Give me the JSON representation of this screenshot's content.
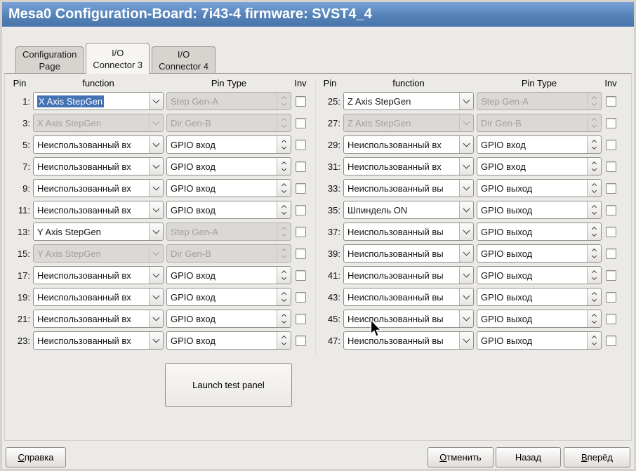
{
  "window": {
    "title": "Mesa0 Configuration-Board: 7i43-4 firmware: SVST4_4"
  },
  "colors": {
    "titlebar_blue": "#5582b8",
    "selection_blue": "#4272b4"
  },
  "tabs": [
    {
      "line1": "Configuration",
      "line2": "Page",
      "active": false
    },
    {
      "line1": "I/O",
      "line2": "Connector 3",
      "active": true
    },
    {
      "line1": "I/O",
      "line2": "Connector 4",
      "active": false
    }
  ],
  "columns": {
    "pin": "Pin",
    "function": "function",
    "pin_type": "Pin Type",
    "inv": "Inv"
  },
  "left_rows": [
    {
      "pin": "1:",
      "function": "X Axis StepGen",
      "function_disabled": false,
      "function_selected": true,
      "pin_type": "Step Gen-A",
      "pin_type_disabled": true,
      "inv_checked": false
    },
    {
      "pin": "3:",
      "function": "X Axis StepGen",
      "function_disabled": true,
      "function_selected": false,
      "pin_type": "Dir Gen-B",
      "pin_type_disabled": true,
      "inv_checked": false
    },
    {
      "pin": "5:",
      "function": "Неиспользованный вх",
      "function_disabled": false,
      "function_selected": false,
      "pin_type": "GPIO вход",
      "pin_type_disabled": false,
      "inv_checked": false
    },
    {
      "pin": "7:",
      "function": "Неиспользованный вх",
      "function_disabled": false,
      "function_selected": false,
      "pin_type": "GPIO вход",
      "pin_type_disabled": false,
      "inv_checked": false
    },
    {
      "pin": "9:",
      "function": "Неиспользованный вх",
      "function_disabled": false,
      "function_selected": false,
      "pin_type": "GPIO вход",
      "pin_type_disabled": false,
      "inv_checked": false
    },
    {
      "pin": "11:",
      "function": "Неиспользованный вх",
      "function_disabled": false,
      "function_selected": false,
      "pin_type": "GPIO вход",
      "pin_type_disabled": false,
      "inv_checked": false
    },
    {
      "pin": "13:",
      "function": "Y Axis StepGen",
      "function_disabled": false,
      "function_selected": false,
      "pin_type": "Step Gen-A",
      "pin_type_disabled": true,
      "inv_checked": false
    },
    {
      "pin": "15:",
      "function": "Y Axis StepGen",
      "function_disabled": true,
      "function_selected": false,
      "pin_type": "Dir Gen-B",
      "pin_type_disabled": true,
      "inv_checked": false
    },
    {
      "pin": "17:",
      "function": "Неиспользованный вх",
      "function_disabled": false,
      "function_selected": false,
      "pin_type": "GPIO вход",
      "pin_type_disabled": false,
      "inv_checked": false
    },
    {
      "pin": "19:",
      "function": "Неиспользованный вх",
      "function_disabled": false,
      "function_selected": false,
      "pin_type": "GPIO вход",
      "pin_type_disabled": false,
      "inv_checked": false
    },
    {
      "pin": "21:",
      "function": "Неиспользованный вх",
      "function_disabled": false,
      "function_selected": false,
      "pin_type": "GPIO вход",
      "pin_type_disabled": false,
      "inv_checked": false
    },
    {
      "pin": "23:",
      "function": "Неиспользованный вх",
      "function_disabled": false,
      "function_selected": false,
      "pin_type": "GPIO вход",
      "pin_type_disabled": false,
      "inv_checked": false
    }
  ],
  "right_rows": [
    {
      "pin": "25:",
      "function": "Z Axis StepGen",
      "function_disabled": false,
      "function_selected": false,
      "pin_type": "Step Gen-A",
      "pin_type_disabled": true,
      "inv_checked": false
    },
    {
      "pin": "27:",
      "function": "Z Axis StepGen",
      "function_disabled": true,
      "function_selected": false,
      "pin_type": "Dir Gen-B",
      "pin_type_disabled": true,
      "inv_checked": false
    },
    {
      "pin": "29:",
      "function": "Неиспользованный вх",
      "function_disabled": false,
      "function_selected": false,
      "pin_type": "GPIO вход",
      "pin_type_disabled": false,
      "inv_checked": false
    },
    {
      "pin": "31:",
      "function": "Неиспользованный вх",
      "function_disabled": false,
      "function_selected": false,
      "pin_type": "GPIO вход",
      "pin_type_disabled": false,
      "inv_checked": false
    },
    {
      "pin": "33:",
      "function": "Неиспользованный вы",
      "function_disabled": false,
      "function_selected": false,
      "pin_type": "GPIO выход",
      "pin_type_disabled": false,
      "inv_checked": false
    },
    {
      "pin": "35:",
      "function": "Шпиндель ON",
      "function_disabled": false,
      "function_selected": false,
      "pin_type": "GPIO выход",
      "pin_type_disabled": false,
      "inv_checked": false
    },
    {
      "pin": "37:",
      "function": "Неиспользованный вы",
      "function_disabled": false,
      "function_selected": false,
      "pin_type": "GPIO выход",
      "pin_type_disabled": false,
      "inv_checked": false
    },
    {
      "pin": "39:",
      "function": "Неиспользованный вы",
      "function_disabled": false,
      "function_selected": false,
      "pin_type": "GPIO выход",
      "pin_type_disabled": false,
      "inv_checked": false
    },
    {
      "pin": "41:",
      "function": "Неиспользованный вы",
      "function_disabled": false,
      "function_selected": false,
      "pin_type": "GPIO выход",
      "pin_type_disabled": false,
      "inv_checked": false
    },
    {
      "pin": "43:",
      "function": "Неиспользованный вы",
      "function_disabled": false,
      "function_selected": false,
      "pin_type": "GPIO выход",
      "pin_type_disabled": false,
      "inv_checked": false
    },
    {
      "pin": "45:",
      "function": "Неиспользованный вы",
      "function_disabled": false,
      "function_selected": false,
      "pin_type": "GPIO выход",
      "pin_type_disabled": false,
      "inv_checked": false
    },
    {
      "pin": "47:",
      "function": "Неиспользованный вы",
      "function_disabled": false,
      "function_selected": false,
      "pin_type": "GPIO выход",
      "pin_type_disabled": false,
      "inv_checked": false
    }
  ],
  "test_panel_button": "Launch test panel",
  "footer": {
    "help": {
      "accel": "С",
      "rest": "правка"
    },
    "cancel": {
      "accel": "О",
      "rest": "тменить"
    },
    "back": {
      "accel": "",
      "rest": "Назад"
    },
    "forward": {
      "accel": "В",
      "rest": "перёд"
    }
  }
}
